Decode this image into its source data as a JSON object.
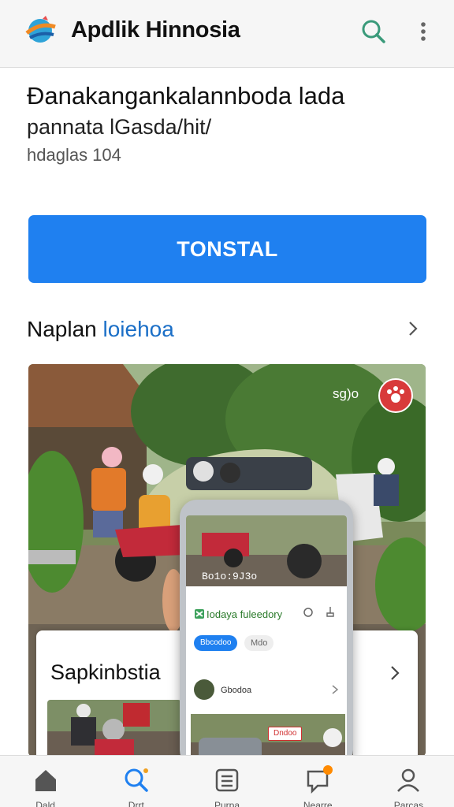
{
  "app": {
    "title": "Apdlik Hinnosia",
    "logo_icon": "globe-swoosh-logo",
    "accent_color": "#1f80f0"
  },
  "header": {
    "search_icon": "search-icon",
    "more_icon": "more-vertical-icon"
  },
  "listing": {
    "headline": "Đanakangankalannboda lada",
    "subline": "pannata lGasda/hit/",
    "meta": "hdaglas 104"
  },
  "install_button": {
    "label": "TONSTAL"
  },
  "section": {
    "title_plain": "Naplan",
    "title_accent": "loiehoa",
    "chevron_icon": "chevron-right-icon"
  },
  "feature": {
    "badge_text": "sg)o",
    "badge_icon": "paw-badge-icon",
    "card_left_title": "Sapkinbstia",
    "card_right_chevron": "chevron-right-icon"
  },
  "phone_mock": {
    "photo_label": "Bo1o:9J3o",
    "app_title": "Iodaya fuleedory",
    "chip_selected": "Bbcodoo",
    "chip_other": "Mdo",
    "row_text": "Gbodoa",
    "tag_text": "Dndoo"
  },
  "tabbar": {
    "items": [
      {
        "label": "Dald",
        "icon": "home-icon"
      },
      {
        "label": "Drrt",
        "icon": "search-icon"
      },
      {
        "label": "Purpa",
        "icon": "list-icon"
      },
      {
        "label": "Nearre",
        "icon": "chat-badge-icon"
      },
      {
        "label": "Parcas",
        "icon": "person-icon"
      }
    ],
    "active_index": 1
  }
}
